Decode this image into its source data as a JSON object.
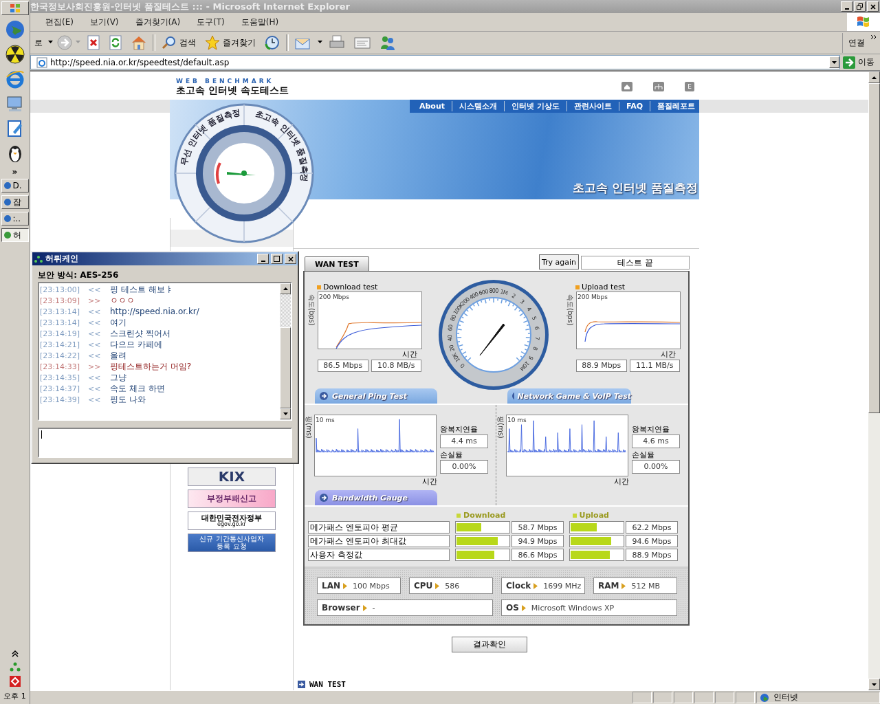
{
  "taskbar": {
    "more": "»",
    "tasks": [
      {
        "label": "D.",
        "selected": false
      },
      {
        "label": "잡",
        "selected": false
      },
      {
        "label": ":..",
        "selected": false
      },
      {
        "label": "허",
        "selected": true
      }
    ],
    "clock": "오후 1"
  },
  "window": {
    "title": "한국정보사회진흥원-인터넷 품질테스트 ::: - Microsoft Internet Explorer",
    "menu": [
      "편집(E)",
      "보기(V)",
      "즐겨찾기(A)",
      "도구(T)",
      "도움말(H)"
    ],
    "toolbar": {
      "back": "로",
      "search": "검색",
      "favorites": "즐겨찾기",
      "links": "연결"
    },
    "address": "http://speed.nia.or.kr/speedtest/default.asp",
    "go": "이동",
    "zone": "인터넷"
  },
  "page": {
    "brand": "WEB BENCHMARK",
    "title": "초고속 인터넷 속도테스트",
    "header_link": "E",
    "nav": [
      "About",
      "시스템소개",
      "인터넷 기상도",
      "관련사이트",
      "FAQ",
      "품질레포트"
    ],
    "slogan": "초고속 인터넷 품질측정",
    "ring_labels": [
      "무선 인터넷 품질측정",
      "초고속 인터넷 품질측정"
    ],
    "side_banners": [
      {
        "kind": "kix",
        "lines": [
          "KIX"
        ]
      },
      {
        "kind": "report",
        "lines": [
          "부정부패신고"
        ]
      },
      {
        "kind": "egov",
        "lines": [
          "대한민국전자정부",
          "egov.go.kr"
        ]
      },
      {
        "kind": "request",
        "lines": [
          "신규 기간통신사업자",
          "등록 요청"
        ]
      }
    ],
    "result_button": "결과확인",
    "section_heading": "WAN TEST"
  },
  "wan": {
    "tab": "WAN TEST",
    "try_again": "Try again",
    "status": "테스트 끝",
    "tests": [
      {
        "title": "Download test",
        "ylabel": "속도(bps)",
        "max": "200 Mbps",
        "xlabel": "시간",
        "mbps": "86.5 Mbps",
        "mbs": "10.8 MB/s"
      },
      {
        "title": "Upload test",
        "ylabel": "속도(bps)",
        "max": "200 Mbps",
        "xlabel": "시간",
        "mbps": "88.9 Mbps",
        "mbs": "11.1 MB/s"
      }
    ],
    "gauge_labels": [
      "0",
      "10K",
      "20",
      "40",
      "60",
      "80",
      "100K",
      "200",
      "400",
      "600",
      "800",
      "1M",
      "2",
      "3",
      "4",
      "5",
      "6",
      "7",
      "8",
      "9",
      "10M"
    ],
    "ping": [
      {
        "tab": "General Ping Test",
        "ylabel": "핑(ms)",
        "max": "10 ms",
        "xlabel": "시간",
        "latency_label": "왕복지연율",
        "latency": "4.4 ms",
        "loss_label": "손실율",
        "loss": "0.00%"
      },
      {
        "tab": "Network Game & VoIP Test",
        "ylabel": "핑(ms)",
        "max": "10 ms",
        "xlabel": "시간",
        "latency_label": "왕복지연율",
        "latency": "4.6 ms",
        "loss_label": "손실율",
        "loss": "0.00%"
      }
    ],
    "bandwidth_tab": "Bandwidth Gauge",
    "bandwidth": {
      "columns": [
        "Download",
        "Upload"
      ],
      "rows": [
        {
          "label": "메가패스 엔토피아 평균",
          "download": {
            "level": 0.48,
            "value": "58.7 Mbps"
          },
          "upload": {
            "level": 0.5,
            "value": "62.2 Mbps"
          }
        },
        {
          "label": "메가패스 엔토피아 최대값",
          "download": {
            "level": 0.79,
            "value": "94.9 Mbps"
          },
          "upload": {
            "level": 0.77,
            "value": "94.6 Mbps"
          }
        },
        {
          "label": "사용자 측정값",
          "download": {
            "level": 0.72,
            "value": "86.6 Mbps"
          },
          "upload": {
            "level": 0.75,
            "value": "88.9 Mbps"
          }
        }
      ]
    },
    "system": [
      {
        "label": "LAN",
        "value": "100 Mbps"
      },
      {
        "label": "CPU",
        "value": "586"
      },
      {
        "label": "Clock",
        "value": "1699 MHz"
      },
      {
        "label": "RAM",
        "value": "512 MB"
      },
      {
        "label": "Browser",
        "value": "-"
      },
      {
        "label": "OS",
        "value": "Microsoft Windows XP"
      }
    ]
  },
  "chat": {
    "title": "허뤼케인",
    "security": "보안 방식: AES-256",
    "messages": [
      {
        "time": "[23:13:00]",
        "dir": "<<",
        "text": "핑 테스트 해보ㅑ",
        "kind": "received"
      },
      {
        "time": "[23:13:09]",
        "dir": ">>",
        "text": "ㅇㅇㅇ",
        "kind": "sent"
      },
      {
        "time": "[23:13:14]",
        "dir": "<<",
        "text": "http://speed.nia.or.kr/",
        "kind": "received"
      },
      {
        "time": "[23:13:14]",
        "dir": "<<",
        "text": "여기",
        "kind": "received"
      },
      {
        "time": "[23:14:19]",
        "dir": "<<",
        "text": "스크린샷 찍어서",
        "kind": "received"
      },
      {
        "time": "[23:14:21]",
        "dir": "<<",
        "text": "다으므 카페에",
        "kind": "received"
      },
      {
        "time": "[23:14:22]",
        "dir": "<<",
        "text": "올려",
        "kind": "received"
      },
      {
        "time": "[23:14:33]",
        "dir": ">>",
        "text": "핑테스트하는거 머임?",
        "kind": "sent"
      },
      {
        "time": "[23:14:35]",
        "dir": "<<",
        "text": "그냥",
        "kind": "received"
      },
      {
        "time": "[23:14:37]",
        "dir": "<<",
        "text": "속도 체크 하면",
        "kind": "received"
      },
      {
        "time": "[23:14:39]",
        "dir": "<<",
        "text": "핑도 나와",
        "kind": "received"
      }
    ]
  }
}
